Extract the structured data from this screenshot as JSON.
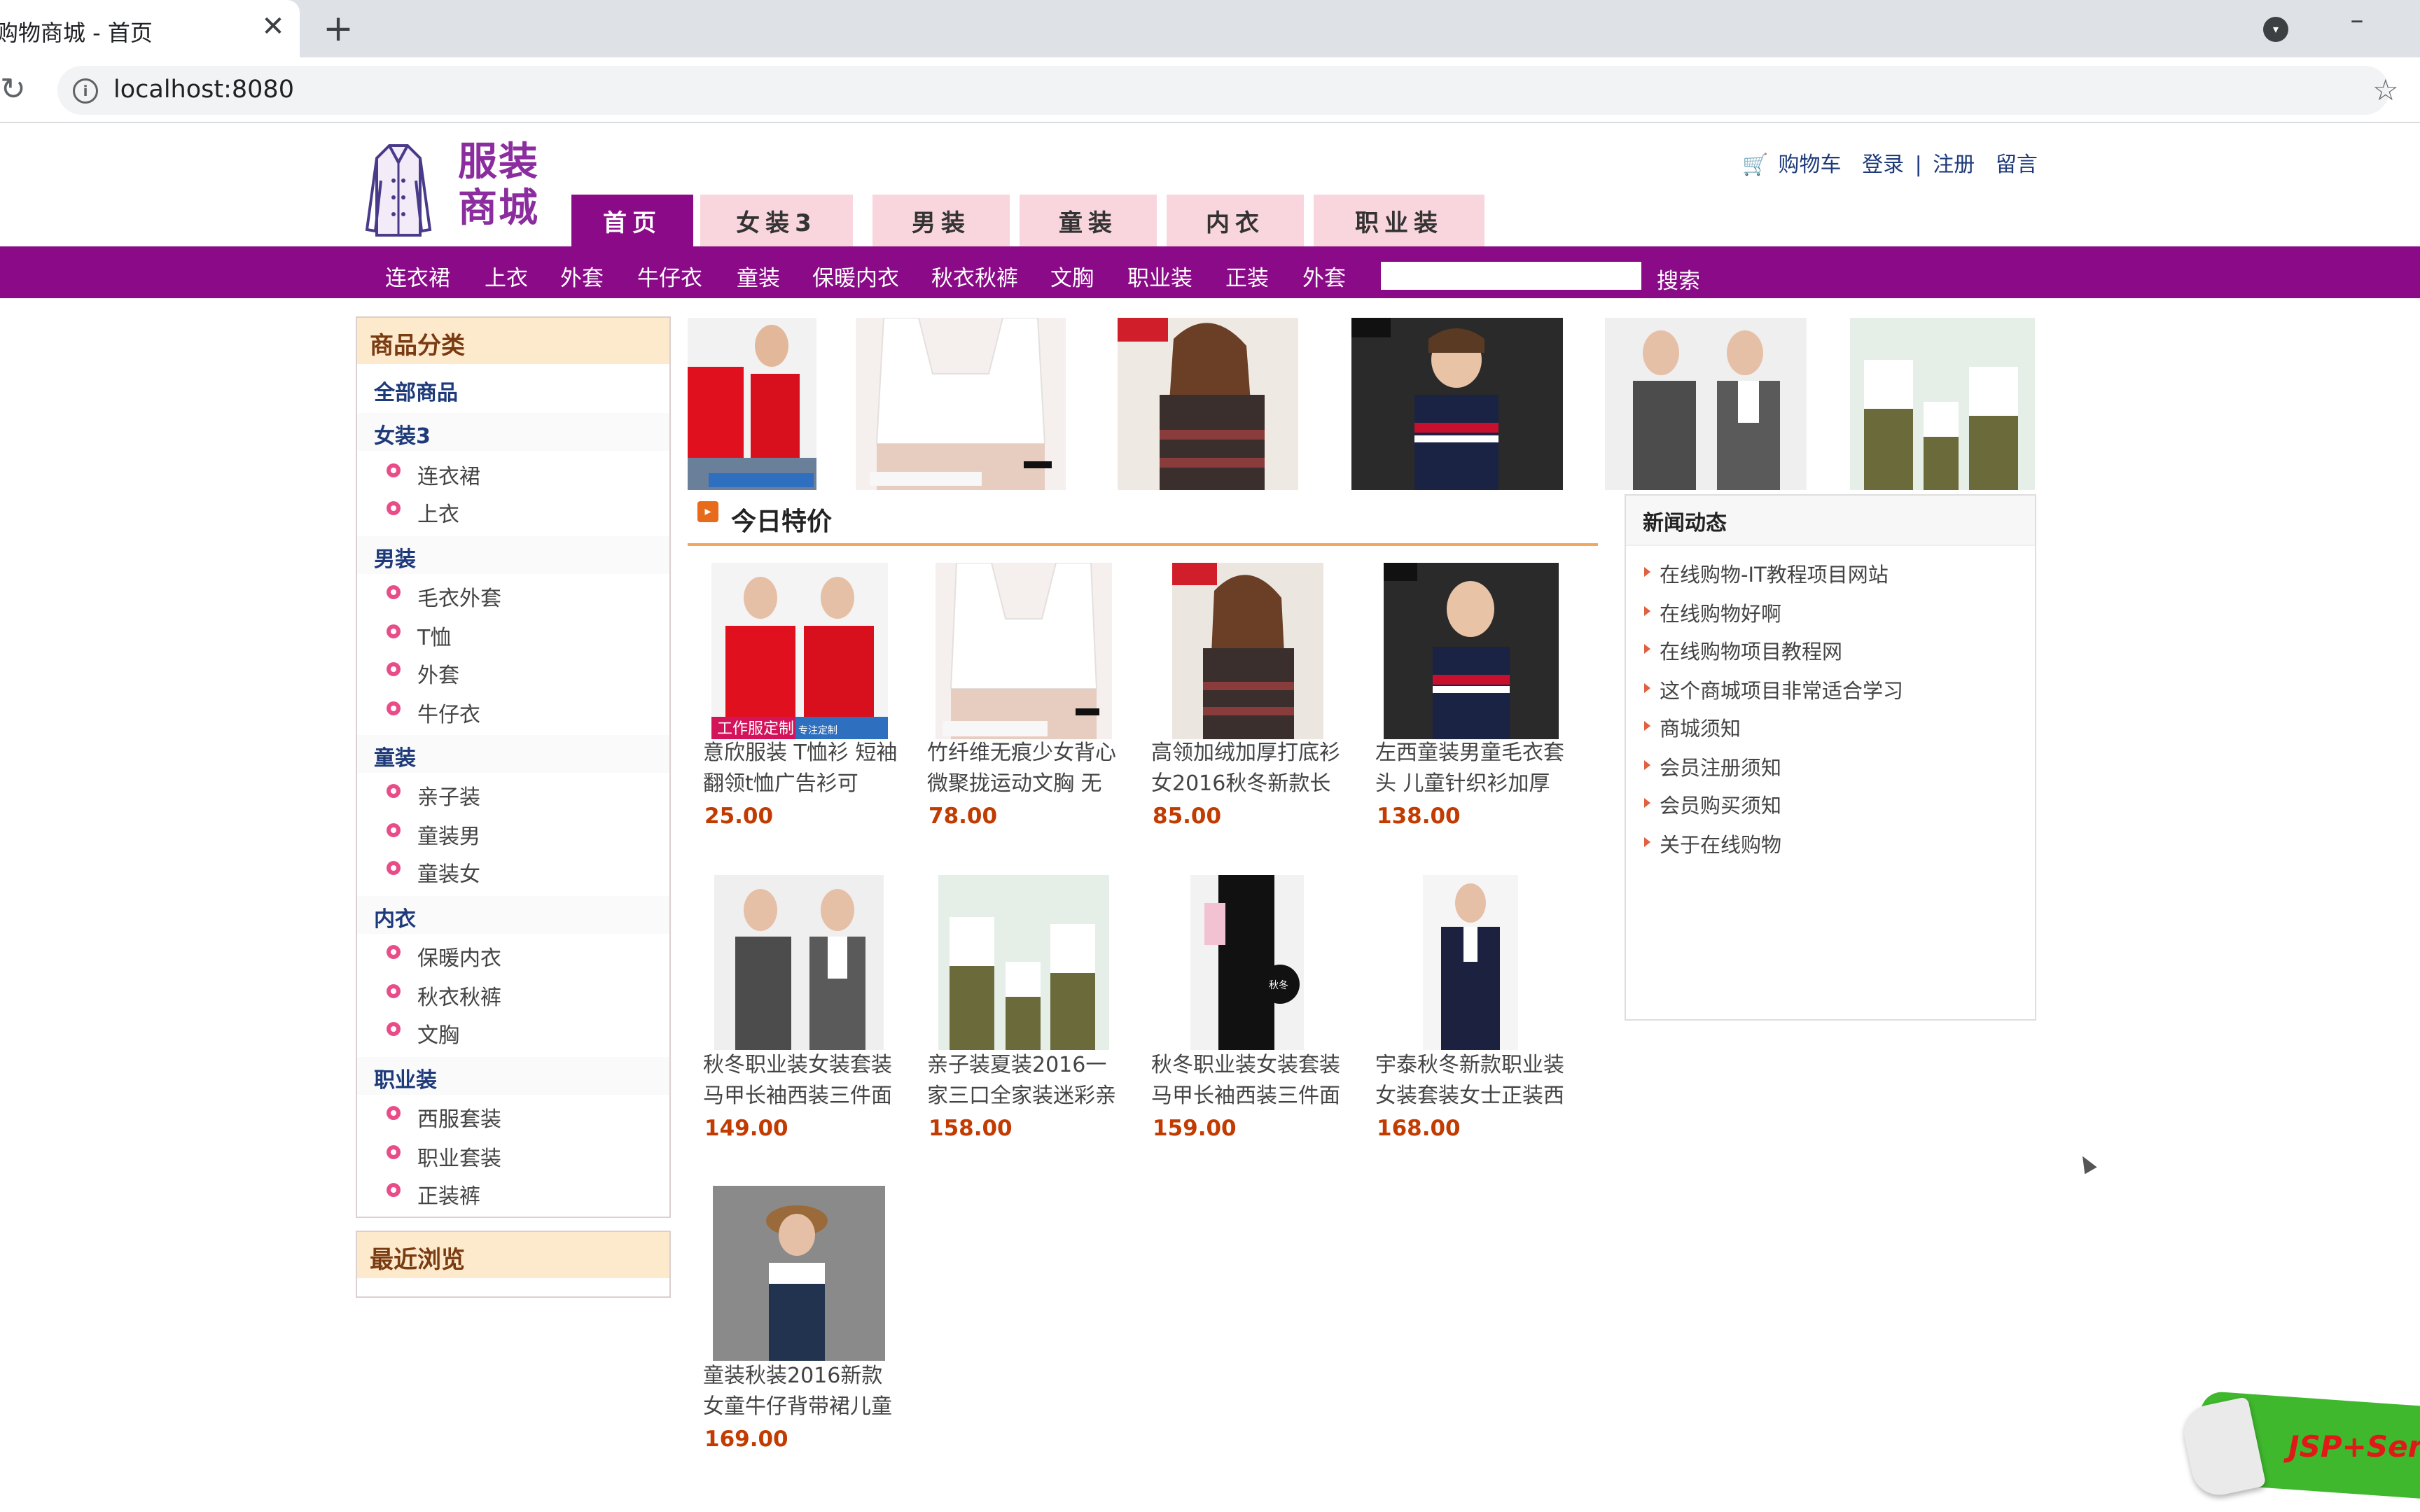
{
  "browser": {
    "tab_title": "购物商城 - 首页",
    "tab_close": "✕",
    "new_tab": "+",
    "url": "localhost:8080"
  },
  "site": {
    "logo_text": "服装商城",
    "main_tabs": [
      "首页",
      "女装3",
      "男装",
      "童装",
      "内衣",
      "职业装"
    ],
    "active_tab": "首页",
    "top_links": {
      "cart": "购物车",
      "login": "登录",
      "sep": "|",
      "register": "注册",
      "message": "留言"
    },
    "category_links": [
      "连衣裙",
      "上衣",
      "外套",
      "牛仔衣",
      "童装",
      "保暖内衣",
      "秋衣秋裤",
      "文胸",
      "职业装",
      "正装",
      "外套"
    ],
    "search": {
      "button": "搜索",
      "value": ""
    }
  },
  "sidebar": {
    "title": "商品分类",
    "all_products": "全部商品",
    "groups": [
      {
        "name": "女装3",
        "items": [
          "连衣裙",
          "上衣"
        ]
      },
      {
        "name": "男装",
        "items": [
          "毛衣外套",
          "T恤",
          "外套",
          "牛仔衣"
        ]
      },
      {
        "name": "童装",
        "items": [
          "亲子装",
          "童装男",
          "童装女"
        ]
      },
      {
        "name": "内衣",
        "items": [
          "保暖内衣",
          "秋衣秋裤",
          "文胸"
        ]
      },
      {
        "name": "职业装",
        "items": [
          "西服套装",
          "职业套装",
          "正装裤"
        ]
      }
    ],
    "recent_title": "最近浏览"
  },
  "special": {
    "title": "今日特价",
    "products": [
      {
        "name": "意欣服装 T恤衫 短袖翻领t恤广告衫可",
        "price": "25.00"
      },
      {
        "name": "竹纤维无痕少女背心 微聚拢运动文胸 无",
        "price": "78.00"
      },
      {
        "name": "高领加绒加厚打底衫 女2016秋冬新款长",
        "price": "85.00"
      },
      {
        "name": "左西童装男童毛衣套头 儿童针织衫加厚",
        "price": "138.00"
      },
      {
        "name": "秋冬职业装女装套装 马甲长袖西装三件面",
        "price": "149.00"
      },
      {
        "name": "亲子装夏装2016一家三口全家装迷彩亲",
        "price": "158.00"
      },
      {
        "name": "秋冬职业装女装套装 马甲长袖西装三件面",
        "price": "159.00"
      },
      {
        "name": "宇泰秋冬新款职业装 女装套装女士正装西",
        "price": "168.00"
      },
      {
        "name": "童装秋装2016新款 女童牛仔背带裙儿童",
        "price": "169.00"
      }
    ],
    "image_labels": [
      "工作服定制",
      "专注定制",
      "秋冬"
    ]
  },
  "news": {
    "title": "新闻动态",
    "items": [
      "在线购物-IT教程项目网站",
      "在线购物好啊",
      "在线购物项目教程网",
      "这个商城项目非常适合学习",
      "商城须知",
      "会员注册须知",
      "会员购买须知",
      "关于在线购物"
    ]
  },
  "overlay": {
    "badge_text": "JSP+Serv"
  }
}
